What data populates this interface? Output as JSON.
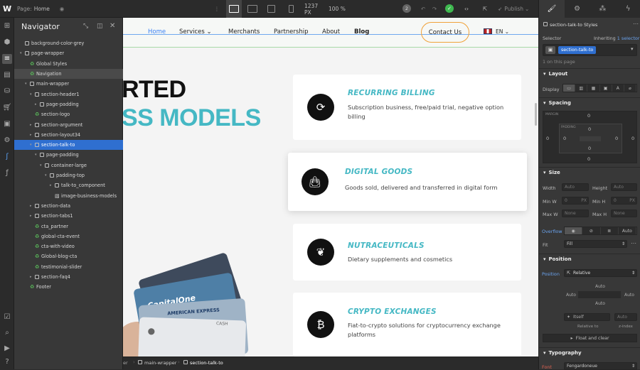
{
  "topbar": {
    "page_label": "Page:",
    "page_name": "Home",
    "width_value": "1237 PX",
    "zoom": "100 %",
    "badge_count": "2",
    "publish_label": "Publish"
  },
  "navigator": {
    "title": "Navigator",
    "items": [
      {
        "label": "background-color-grey",
        "type": "box",
        "depth": 0,
        "caret": "",
        "state": ""
      },
      {
        "label": "page-wrapper",
        "type": "box",
        "depth": 0,
        "caret": "open",
        "state": ""
      },
      {
        "label": "Global Styles",
        "type": "sym",
        "depth": 1,
        "caret": "",
        "state": ""
      },
      {
        "label": "Navigation",
        "type": "sym",
        "depth": 1,
        "caret": "",
        "state": "hl"
      },
      {
        "label": "main-wrapper",
        "type": "box",
        "depth": 1,
        "caret": "open",
        "state": ""
      },
      {
        "label": "section-header1",
        "type": "box",
        "depth": 2,
        "caret": "open",
        "state": ""
      },
      {
        "label": "page-padding",
        "type": "box",
        "depth": 3,
        "caret": "closed",
        "state": ""
      },
      {
        "label": "section-logo",
        "type": "sym",
        "depth": 2,
        "caret": "",
        "state": ""
      },
      {
        "label": "section-argument",
        "type": "box",
        "depth": 2,
        "caret": "closed",
        "state": ""
      },
      {
        "label": "section-layout34",
        "type": "box",
        "depth": 2,
        "caret": "closed",
        "state": ""
      },
      {
        "label": "section-talk-to",
        "type": "box",
        "depth": 2,
        "caret": "open",
        "state": "sel"
      },
      {
        "label": "page-padding",
        "type": "box",
        "depth": 3,
        "caret": "open",
        "state": ""
      },
      {
        "label": "container-large",
        "type": "box",
        "depth": 4,
        "caret": "open",
        "state": ""
      },
      {
        "label": "padding-top",
        "type": "box",
        "depth": 5,
        "caret": "open",
        "state": ""
      },
      {
        "label": "talk-to_component",
        "type": "box",
        "depth": 6,
        "caret": "closed",
        "state": ""
      },
      {
        "label": "image-business-models",
        "type": "img",
        "depth": 6,
        "caret": "",
        "state": ""
      },
      {
        "label": "section-data",
        "type": "box",
        "depth": 2,
        "caret": "closed",
        "state": ""
      },
      {
        "label": "section-tabs1",
        "type": "box",
        "depth": 2,
        "caret": "closed",
        "state": ""
      },
      {
        "label": "cta_partner",
        "type": "sym",
        "depth": 2,
        "caret": "",
        "state": ""
      },
      {
        "label": "global-cta-event",
        "type": "sym",
        "depth": 2,
        "caret": "",
        "state": ""
      },
      {
        "label": "cta-with-video",
        "type": "sym",
        "depth": 2,
        "caret": "",
        "state": ""
      },
      {
        "label": "Global-blog-cta",
        "type": "sym",
        "depth": 2,
        "caret": "",
        "state": ""
      },
      {
        "label": "testimonial-slider",
        "type": "sym",
        "depth": 2,
        "caret": "",
        "state": ""
      },
      {
        "label": "section-faq4",
        "type": "box",
        "depth": 2,
        "caret": "closed",
        "state": ""
      },
      {
        "label": "Footer",
        "type": "sym",
        "depth": 1,
        "caret": "",
        "state": ""
      }
    ]
  },
  "site": {
    "nav": {
      "home": "Home",
      "services": "Services",
      "merchants": "Merchants",
      "partnership": "Partnership",
      "about": "About",
      "blog": "Blog",
      "contact": "Contact Us",
      "lang": "EN"
    },
    "hero": {
      "line1": "RTED",
      "line2": "SS MODELS"
    },
    "cards": [
      {
        "title": "RECURRING BILLING",
        "desc1": "Subscription business, free/paid trial, negative option",
        "desc2": "billing",
        "icon": "refresh-icon"
      },
      {
        "title": "DIGITAL GOODS",
        "desc1": "Goods sold, delivered and transferred in digital form",
        "desc2": "",
        "icon": "shopping-bag-icon"
      },
      {
        "title": "NUTRACEUTICALS",
        "desc1": "Dietary supplements and cosmetics",
        "desc2": "",
        "icon": "leaf-icon"
      },
      {
        "title": "CRYPTO EXCHANGES",
        "desc1": "Fiat-to-crypto solutions for cryptocurrency exchange",
        "desc2": "platforms",
        "icon": "bitcoin-icon"
      }
    ],
    "card_brands": [
      "CapitalOne",
      "AMERICAN EXPRESS",
      "CASH"
    ]
  },
  "breadcrumbs": [
    "er",
    "main-wrapper",
    "section-talk-to"
  ],
  "right": {
    "element_name": "section-talk-to Styles",
    "selector_label": "Selector",
    "inheriting": "Inheriting",
    "selector_count": "1 selector",
    "selector_tag": "section-talk-to",
    "on_page": "1 on this page",
    "layout": "Layout",
    "display": "Display",
    "spacing": "Spacing",
    "margin": "MARGIN",
    "padding": "PADDING",
    "zeros": "0",
    "size": "Size",
    "width": "Width",
    "height": "Height",
    "minw": "Min W",
    "minh": "Min H",
    "maxw": "Max W",
    "maxh": "Max H",
    "auto": "Auto",
    "none": "None",
    "px": "PX",
    "overflow": "Overflow",
    "fit": "Fit",
    "fit_value": "Fill",
    "position_hd": "Position",
    "position": "Position",
    "position_value": "Relative",
    "itself": "Itself",
    "relative_to": "Relative to",
    "zindex": "z-index",
    "float": "Float and clear",
    "typography": "Typography",
    "font": "Font",
    "font_value": "Fengardoneue"
  },
  "colors": {
    "accent": "#45b8c4",
    "selection": "#2f6fd0",
    "contact_border": "#f0a23a"
  }
}
